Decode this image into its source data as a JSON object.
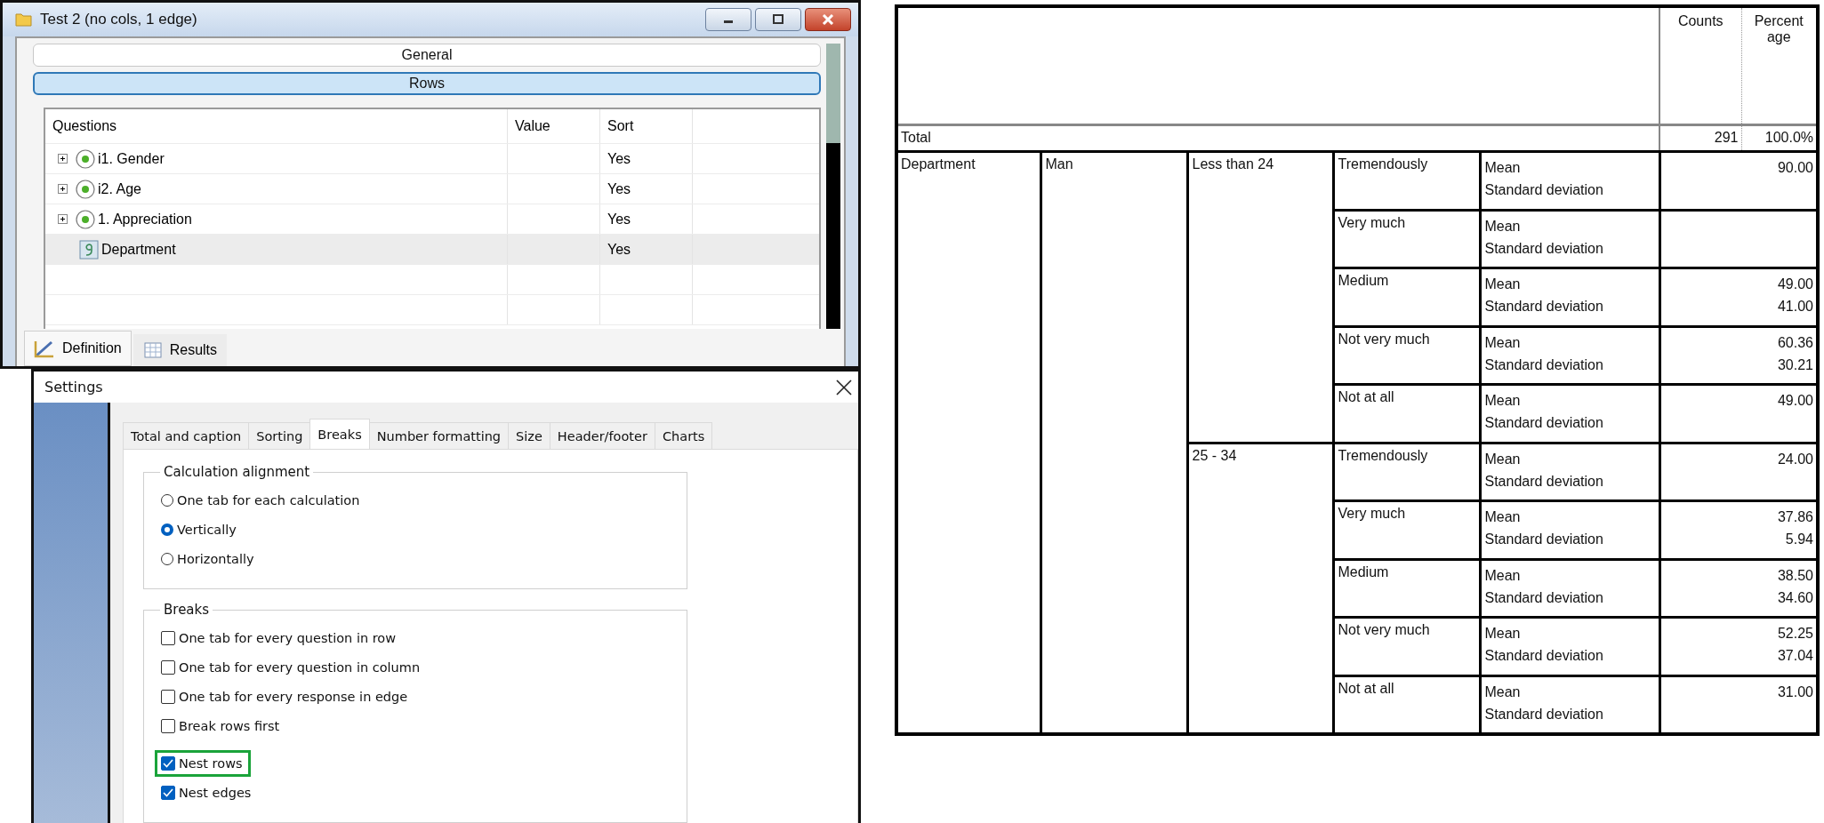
{
  "window": {
    "title": "Test 2 (no cols, 1 edge)",
    "sections": [
      {
        "label": "General",
        "selected": false
      },
      {
        "label": "Rows",
        "selected": true
      }
    ],
    "grid": {
      "columns": [
        "Questions",
        "Value",
        "Sort"
      ],
      "rows": [
        {
          "kind": "group",
          "question": "i1. Gender",
          "sort": "Yes",
          "selected": false
        },
        {
          "kind": "group",
          "question": "i2. Age",
          "sort": "Yes",
          "selected": false
        },
        {
          "kind": "group",
          "question": "1. Appreciation",
          "sort": "Yes",
          "selected": false
        },
        {
          "kind": "numeric",
          "question": "Department",
          "sort": "Yes",
          "selected": true
        }
      ]
    },
    "bottom_tabs": [
      {
        "kind": "definition",
        "label": "Definition",
        "selected": true
      },
      {
        "kind": "results",
        "label": "Results",
        "selected": false
      }
    ]
  },
  "settings": {
    "title": "Settings",
    "tabs": [
      {
        "label": "Total and caption",
        "selected": false
      },
      {
        "label": "Sorting",
        "selected": false
      },
      {
        "label": "Breaks",
        "selected": true
      },
      {
        "label": "Number formatting",
        "selected": false
      },
      {
        "label": "Size",
        "selected": false
      },
      {
        "label": "Header/footer",
        "selected": false
      },
      {
        "label": "Charts",
        "selected": false
      }
    ],
    "groups": [
      {
        "title": "Calculation alignment",
        "kind": "radio",
        "option_sets": [
          [
            {
              "label": "One tab for each calculation",
              "selected": false
            },
            {
              "label": "Vertically",
              "selected": true
            },
            {
              "label": "Horizontally",
              "selected": false
            }
          ]
        ]
      },
      {
        "title": "Breaks",
        "kind": "checkbox",
        "option_sets": [
          [
            {
              "label": "One tab for every question in row",
              "checked": false,
              "highlighted": false
            },
            {
              "label": "One tab for every question in column",
              "checked": false,
              "highlighted": false
            },
            {
              "label": "One tab for every response in edge",
              "checked": false,
              "highlighted": false
            },
            {
              "label": "Break rows first",
              "checked": false,
              "highlighted": false
            }
          ],
          [
            {
              "label": "Nest rows",
              "checked": true,
              "highlighted": true
            },
            {
              "label": "Nest edges",
              "checked": true,
              "highlighted": false
            }
          ]
        ]
      }
    ]
  },
  "table": {
    "columns": [
      "Counts",
      "Percentage"
    ],
    "total": {
      "label": "Total",
      "counts": "291",
      "percentage": "100.0%"
    },
    "rows": [
      {
        "dimension": "Department",
        "category": "Man",
        "groups": [
          {
            "label": "Less than 24",
            "levels": [
              {
                "label": "Tremendously",
                "stats": [
                  {
                    "label": "Mean",
                    "value": "90.00"
                  },
                  {
                    "label": "Standard deviation"
                  }
                ]
              },
              {
                "label": "Very much",
                "stats": [
                  {
                    "label": "Mean"
                  },
                  {
                    "label": "Standard deviation"
                  }
                ]
              },
              {
                "label": "Medium",
                "stats": [
                  {
                    "label": "Mean",
                    "value": "49.00"
                  },
                  {
                    "label": "Standard deviation",
                    "value": "41.00"
                  }
                ]
              },
              {
                "label": "Not very much",
                "stats": [
                  {
                    "label": "Mean",
                    "value": "60.36"
                  },
                  {
                    "label": "Standard deviation",
                    "value": "30.21"
                  }
                ]
              },
              {
                "label": "Not at all",
                "stats": [
                  {
                    "label": "Mean",
                    "value": "49.00"
                  },
                  {
                    "label": "Standard deviation"
                  }
                ]
              }
            ]
          },
          {
            "label": "25 - 34",
            "levels": [
              {
                "label": "Tremendously",
                "stats": [
                  {
                    "label": "Mean",
                    "value": "24.00"
                  },
                  {
                    "label": "Standard deviation"
                  }
                ]
              },
              {
                "label": "Very much",
                "stats": [
                  {
                    "label": "Mean",
                    "value": "37.86"
                  },
                  {
                    "label": "Standard deviation",
                    "value": "5.94"
                  }
                ]
              },
              {
                "label": "Medium",
                "stats": [
                  {
                    "label": "Mean",
                    "value": "38.50"
                  },
                  {
                    "label": "Standard deviation",
                    "value": "34.60"
                  }
                ]
              },
              {
                "label": "Not very much",
                "stats": [
                  {
                    "label": "Mean",
                    "value": "52.25"
                  },
                  {
                    "label": "Standard deviation",
                    "value": "37.04"
                  }
                ]
              },
              {
                "label": "Not at all",
                "stats": [
                  {
                    "label": "Mean",
                    "value": "31.00"
                  },
                  {
                    "label": "Standard deviation"
                  }
                ]
              }
            ]
          }
        ]
      }
    ]
  }
}
